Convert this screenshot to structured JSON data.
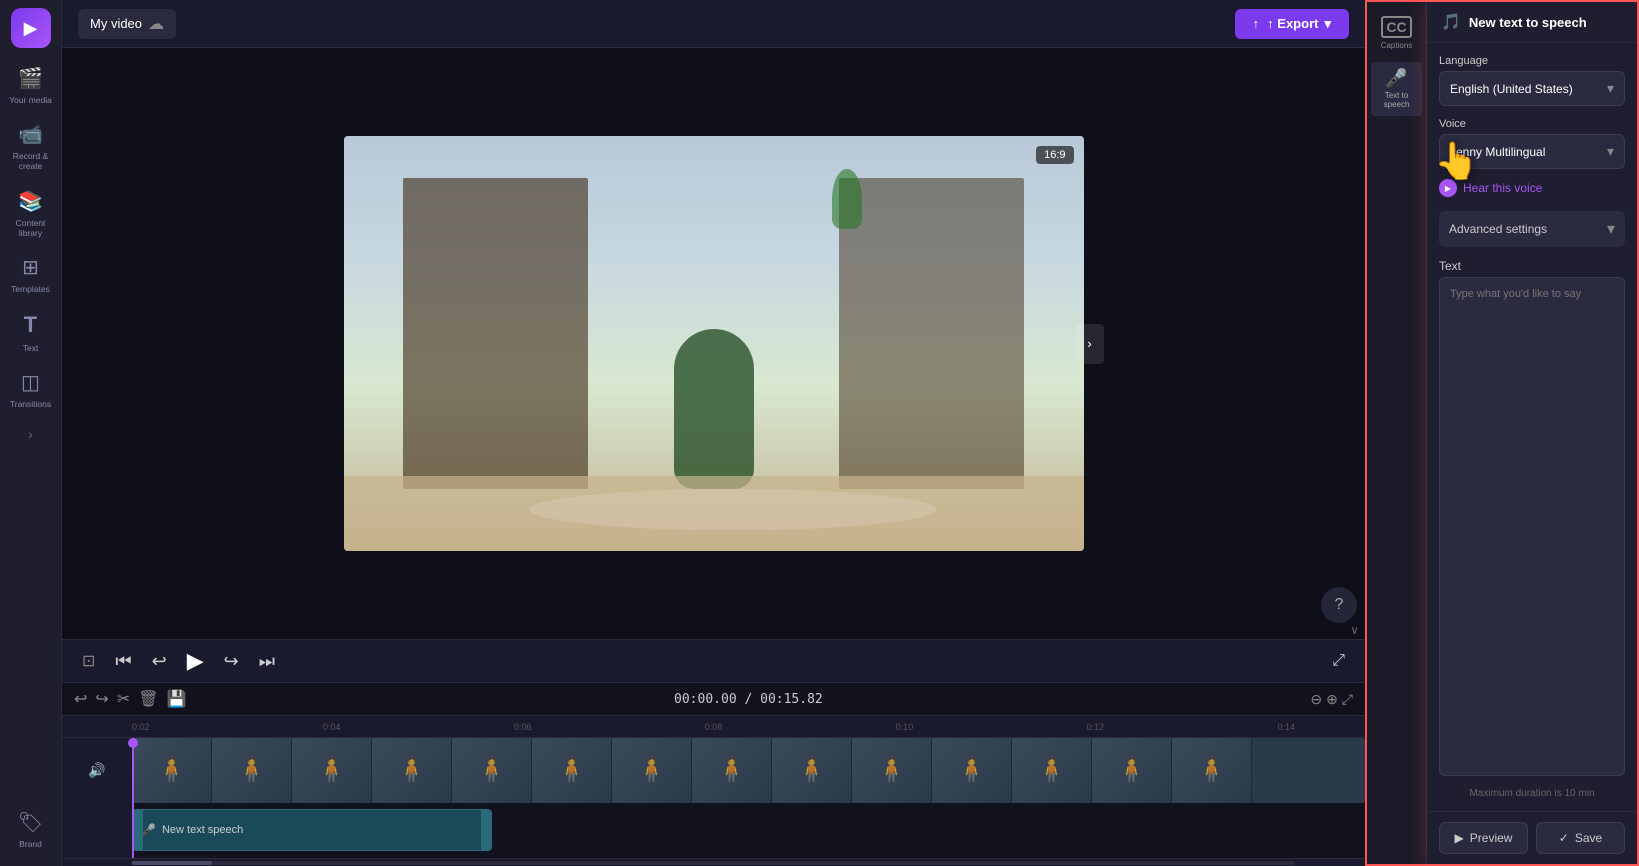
{
  "app": {
    "logo": "▶",
    "project_name": "My video",
    "export_label": "↑ Export"
  },
  "sidebar": {
    "items": [
      {
        "id": "your-media",
        "icon": "🎬",
        "label": "Your media"
      },
      {
        "id": "record",
        "icon": "📹",
        "label": "Record & create"
      },
      {
        "id": "content-library",
        "icon": "📚",
        "label": "Content library"
      },
      {
        "id": "templates",
        "icon": "⊞",
        "label": "Templates"
      },
      {
        "id": "text",
        "icon": "T",
        "label": "Text"
      },
      {
        "id": "transitions",
        "icon": "◫",
        "label": "Transitions"
      },
      {
        "id": "brand-kit",
        "icon": "🏷",
        "label": "Brand"
      }
    ],
    "expand_icon": "›"
  },
  "video": {
    "aspect_ratio": "16:9",
    "time_current": "00:00.00",
    "time_total": "00:15.82"
  },
  "controls": {
    "skip_back": "⏮",
    "rewind": "↩",
    "play": "▶",
    "forward": "↪",
    "skip_forward": "⏭",
    "monitor": "⊡",
    "fullscreen": "⤢"
  },
  "timeline": {
    "tools": [
      "↩",
      "↪",
      "✂",
      "🗑",
      "💾"
    ],
    "time_display": "00:00.00 / 00:15.82",
    "ruler_marks": [
      "0:02",
      "0:04",
      "0:06",
      "0:08",
      "0:10",
      "0:12",
      "0:14"
    ],
    "zoom_in": "+",
    "zoom_out": "-",
    "expand": "⤢"
  },
  "timeline_track": {
    "audio_label": "🔊",
    "clip_label": "New text speech"
  },
  "right_panel": {
    "tabs": [
      {
        "id": "captions",
        "icon": "CC",
        "label": "Captions"
      },
      {
        "id": "text-to-speech",
        "icon": "🎤",
        "label": "Text to speech"
      }
    ]
  },
  "tts_panel": {
    "header_icon": "🎵",
    "title": "New text to speech",
    "language_label": "Language",
    "language_value": "English (United States)",
    "language_chevron": "▾",
    "voice_label": "Voice",
    "voice_value": "Jenny Multilingual",
    "voice_chevron": "▾",
    "hear_voice_label": "Hear this voice",
    "advanced_label": "Advanced settings",
    "advanced_chevron": "▾",
    "text_label": "Text",
    "text_placeholder": "Type what you'd like to say",
    "max_duration": "Maximum duration is 10 min",
    "preview_icon": "▶",
    "preview_label": "Preview",
    "save_icon": "✓",
    "save_label": "Save"
  }
}
